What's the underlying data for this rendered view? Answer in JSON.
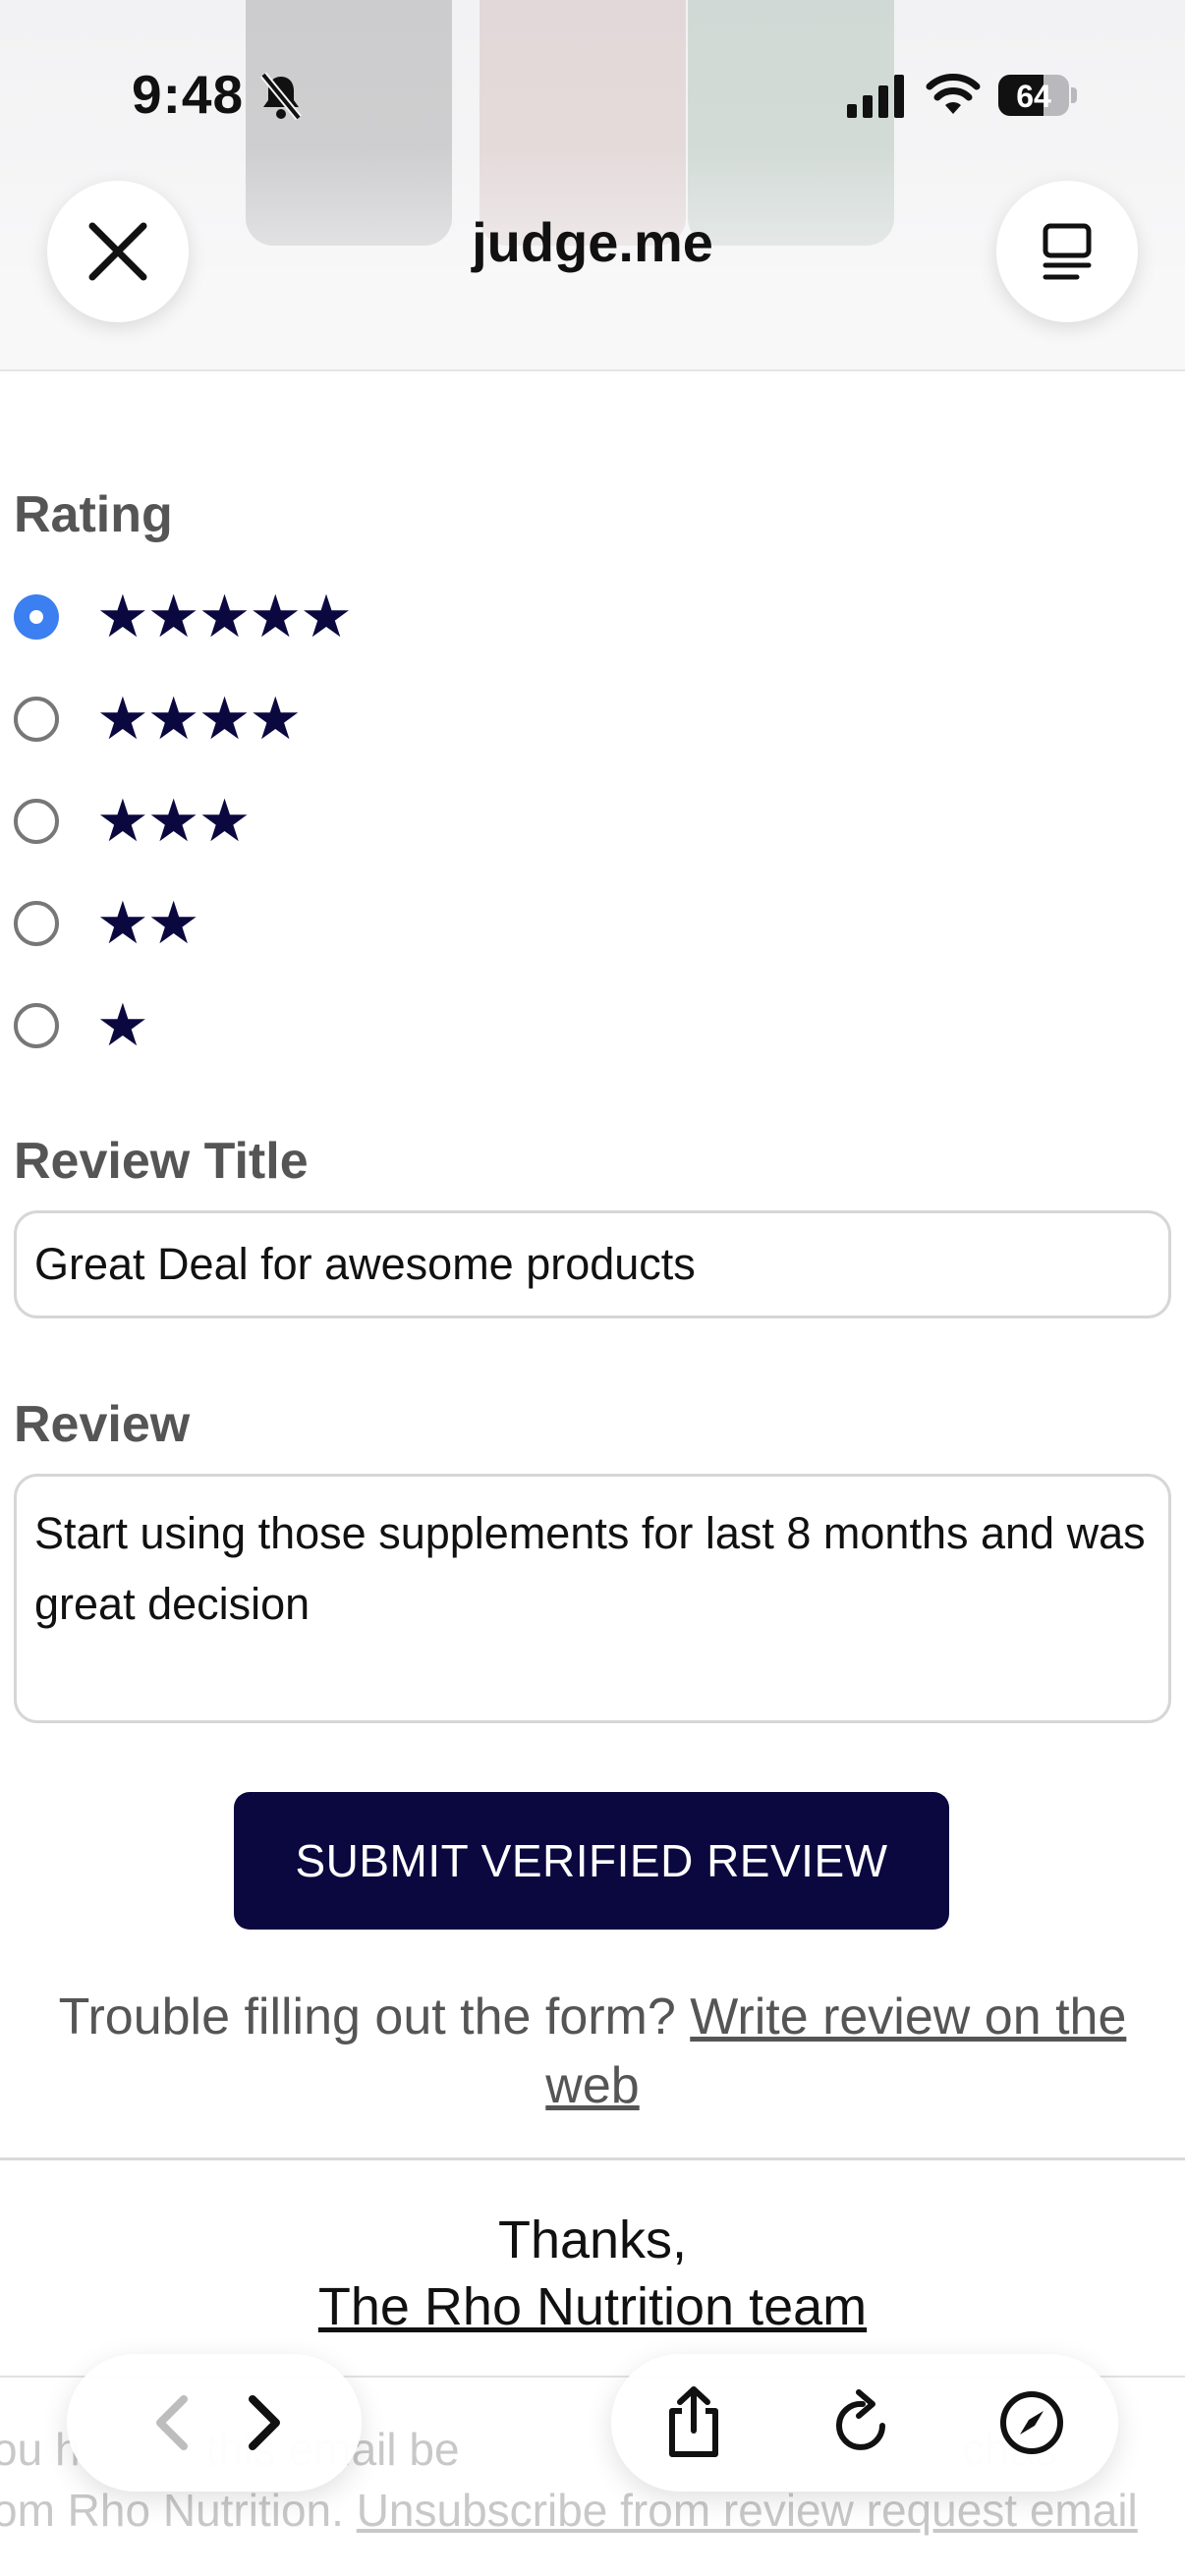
{
  "status_bar": {
    "time": "9:48",
    "battery": "64",
    "battery_level": 0.64
  },
  "browser": {
    "site_title": "judge.me"
  },
  "form": {
    "rating_label": "Rating",
    "rating_options": [
      {
        "stars": "★★★★★",
        "selected": true
      },
      {
        "stars": "★★★★",
        "selected": false
      },
      {
        "stars": "★★★",
        "selected": false
      },
      {
        "stars": "★★",
        "selected": false
      },
      {
        "stars": "★",
        "selected": false
      }
    ],
    "title_label": "Review Title",
    "title_value": "Great Deal for awesome products",
    "review_label": "Review",
    "review_value": "Start using those supplements for last 8 months and was great decision",
    "submit_label": "SUBMIT VERIFIED REVIEW"
  },
  "help": {
    "text": "Trouble filling out the form?",
    "link": "Write review on the web"
  },
  "signoff": {
    "thanks": "Thanks,",
    "team_link": "The Rho Nutrition team"
  },
  "footer": {
    "line1": "ou h          this email be                                        chas",
    "line2_prefix": "om Rho Nutrition.",
    "unsubscribe_link": "Unsubscribe from review request email"
  },
  "icons": {
    "close": "close-icon",
    "reader": "reader-mode-icon",
    "back": "chevron-left-icon",
    "forward": "chevron-right-icon",
    "share": "share-icon",
    "reload": "reload-icon",
    "compass": "compass-icon"
  },
  "colors": {
    "accent": "#0b0840",
    "radio_selected": "#3b7ff0"
  }
}
